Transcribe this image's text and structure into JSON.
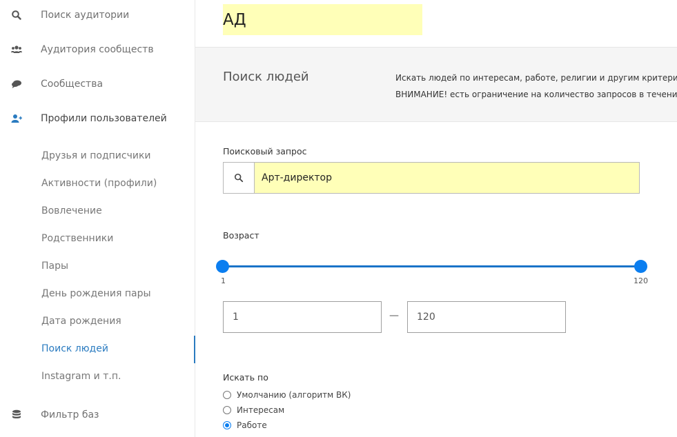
{
  "sidebar": {
    "top_items": [
      {
        "label": "Поиск аудитории",
        "icon": "search-icon"
      },
      {
        "label": "Аудитория сообществ",
        "icon": "users-icon"
      },
      {
        "label": "Сообщества",
        "icon": "comments-icon"
      },
      {
        "label": "Профили пользователей",
        "icon": "user-plus-icon"
      }
    ],
    "sub_items": [
      {
        "label": "Друзья и подписчики"
      },
      {
        "label": "Активности (профили)"
      },
      {
        "label": "Вовлечение"
      },
      {
        "label": "Родственники"
      },
      {
        "label": "Пары"
      },
      {
        "label": "День рождения пары"
      },
      {
        "label": "Дата рождения"
      },
      {
        "label": "Поиск людей",
        "active": true
      },
      {
        "label": "Instagram и т.п."
      }
    ],
    "bottom_item": {
      "label": "Фильтр баз",
      "icon": "database-icon"
    }
  },
  "header": {
    "title": "АД"
  },
  "info": {
    "title": "Поиск людей",
    "line1": "Искать людей по интересам, работе, религии и другим критериям",
    "line2": "ВНИМАНИЕ! есть ограничение на количество запросов в течение часа."
  },
  "search": {
    "label": "Поисковый запрос",
    "value": "Арт-директор"
  },
  "age": {
    "label": "Возраст",
    "min": "1",
    "max": "120",
    "from_value": "1",
    "to_value": "120",
    "dash": "—"
  },
  "search_by": {
    "label": "Искать по",
    "options": [
      {
        "label": "Умолчанию (алгоритм ВК)",
        "checked": false
      },
      {
        "label": "Интересам",
        "checked": false
      },
      {
        "label": "Работе",
        "checked": true
      }
    ]
  },
  "colors": {
    "accent": "#0b7ef0",
    "active_link": "#2a7bc0",
    "highlight": "#ffffb8"
  }
}
